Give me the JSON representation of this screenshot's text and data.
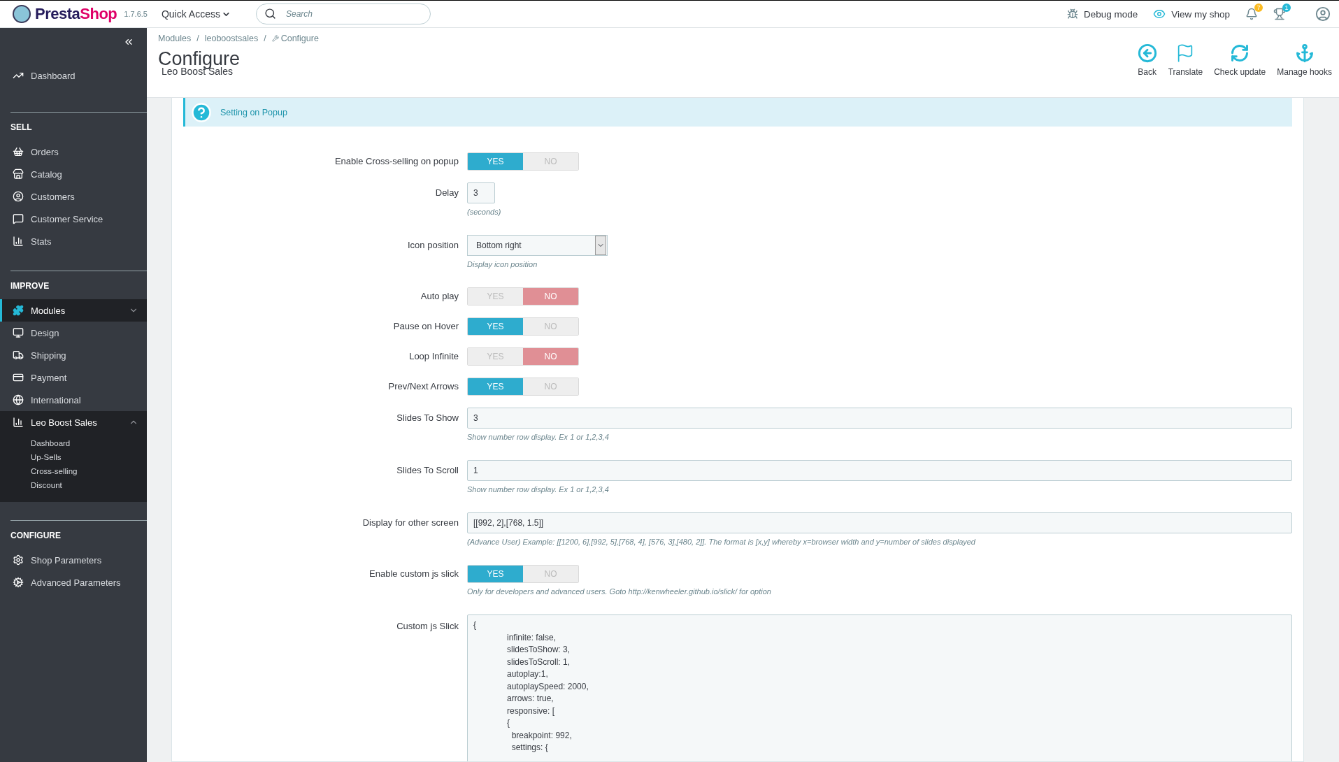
{
  "topbar": {
    "brand_dark": "Presta",
    "brand_pink": "Shop",
    "version": "1.7.6.5",
    "quick_access": "Quick Access",
    "search": {
      "placeholder": "Search"
    },
    "debug": "Debug mode",
    "view_shop": "View my shop",
    "notification_badges": [
      "7",
      "1"
    ]
  },
  "header": {
    "breadcrumb": [
      "Modules",
      "leoboostsales",
      "Configure"
    ],
    "breadcrumb_separators": [
      "/",
      "/"
    ],
    "title": "Configure",
    "subtitle": "Leo Boost Sales",
    "toolbar": [
      {
        "label": "Back"
      },
      {
        "label": "Translate"
      },
      {
        "label": "Check update"
      },
      {
        "label": "Manage hooks"
      }
    ]
  },
  "sidebar": {
    "sections": [
      {
        "items": [
          {
            "label": "Dashboard",
            "selected": false
          }
        ]
      },
      {
        "title": "SELL",
        "items": [
          {
            "label": "Orders",
            "selected": false
          },
          {
            "label": "Catalog",
            "selected": false
          },
          {
            "label": "Customers",
            "selected": false
          },
          {
            "label": "Customer Service",
            "selected": false
          },
          {
            "label": "Stats",
            "selected": false
          }
        ]
      },
      {
        "title": "IMPROVE",
        "items": [
          {
            "label": "Modules",
            "selected": true,
            "expanded": false
          },
          {
            "label": "Design",
            "selected": false
          },
          {
            "label": "Shipping",
            "selected": false
          },
          {
            "label": "Payment",
            "selected": false
          },
          {
            "label": "International",
            "selected": false
          },
          {
            "label": "Leo Boost Sales",
            "selected": false,
            "expanded": true,
            "children": [
              "Dashboard",
              "Up-Sells",
              "Cross-selling",
              "Discount"
            ]
          }
        ]
      },
      {
        "title": "CONFIGURE",
        "items": [
          {
            "label": "Shop Parameters",
            "selected": false
          },
          {
            "label": "Advanced Parameters",
            "selected": false
          }
        ]
      }
    ]
  },
  "form": {
    "info": "Setting on Popup",
    "fields": [
      {
        "kind": "toggle",
        "label": "Enable Cross-selling on popup",
        "on": true,
        "yes": "YES",
        "no": "NO"
      },
      {
        "kind": "short",
        "label": "Delay",
        "value": "3",
        "hint": "(seconds)"
      },
      {
        "kind": "select",
        "label": "Icon position",
        "value": "Bottom right",
        "hint": "Display icon position"
      },
      {
        "kind": "toggle",
        "label": "Auto play",
        "on": false,
        "yes": "YES",
        "no": "NO"
      },
      {
        "kind": "toggle",
        "label": "Pause on Hover",
        "on": true,
        "yes": "YES",
        "no": "NO"
      },
      {
        "kind": "toggle",
        "label": "Loop Infinite",
        "on": false,
        "yes": "YES",
        "no": "NO"
      },
      {
        "kind": "toggle",
        "label": "Prev/Next Arrows",
        "on": true,
        "yes": "YES",
        "no": "NO"
      },
      {
        "kind": "text",
        "label": "Slides To Show",
        "value": "3",
        "hint": "Show number row display. Ex 1 or 1,2,3,4"
      },
      {
        "kind": "text",
        "label": "Slides To Scroll",
        "value": "1",
        "hint": "Show number row display. Ex 1 or 1,2,3,4"
      },
      {
        "kind": "text",
        "label": "Display for other screen",
        "value": "[[992, 2],[768, 1.5]]",
        "hint": "(Advance User) Example: [[1200, 6],[992, 5],[768, 4], [576, 3],[480, 2]]. The format is [x,y] whereby x=browser width and y=number of slides displayed"
      },
      {
        "kind": "toggle",
        "label": "Enable custom js slick",
        "on": true,
        "yes": "YES",
        "no": "NO",
        "hint": "Only for developers and advanced users. Goto http://kenwheeler.github.io/slick/ for option"
      },
      {
        "kind": "textarea",
        "label": "Custom js Slick",
        "value": "{\n\tinfinite: false,\n\tslidesToShow: 3,\n\tslidesToScroll: 1,\n\tautoplay:1,\n\tautoplaySpeed: 2000,\n\tarrows: true,\n\tresponsive: [\n\t{\n\t  breakpoint: 992,\n\t  settings: {"
      }
    ]
  }
}
